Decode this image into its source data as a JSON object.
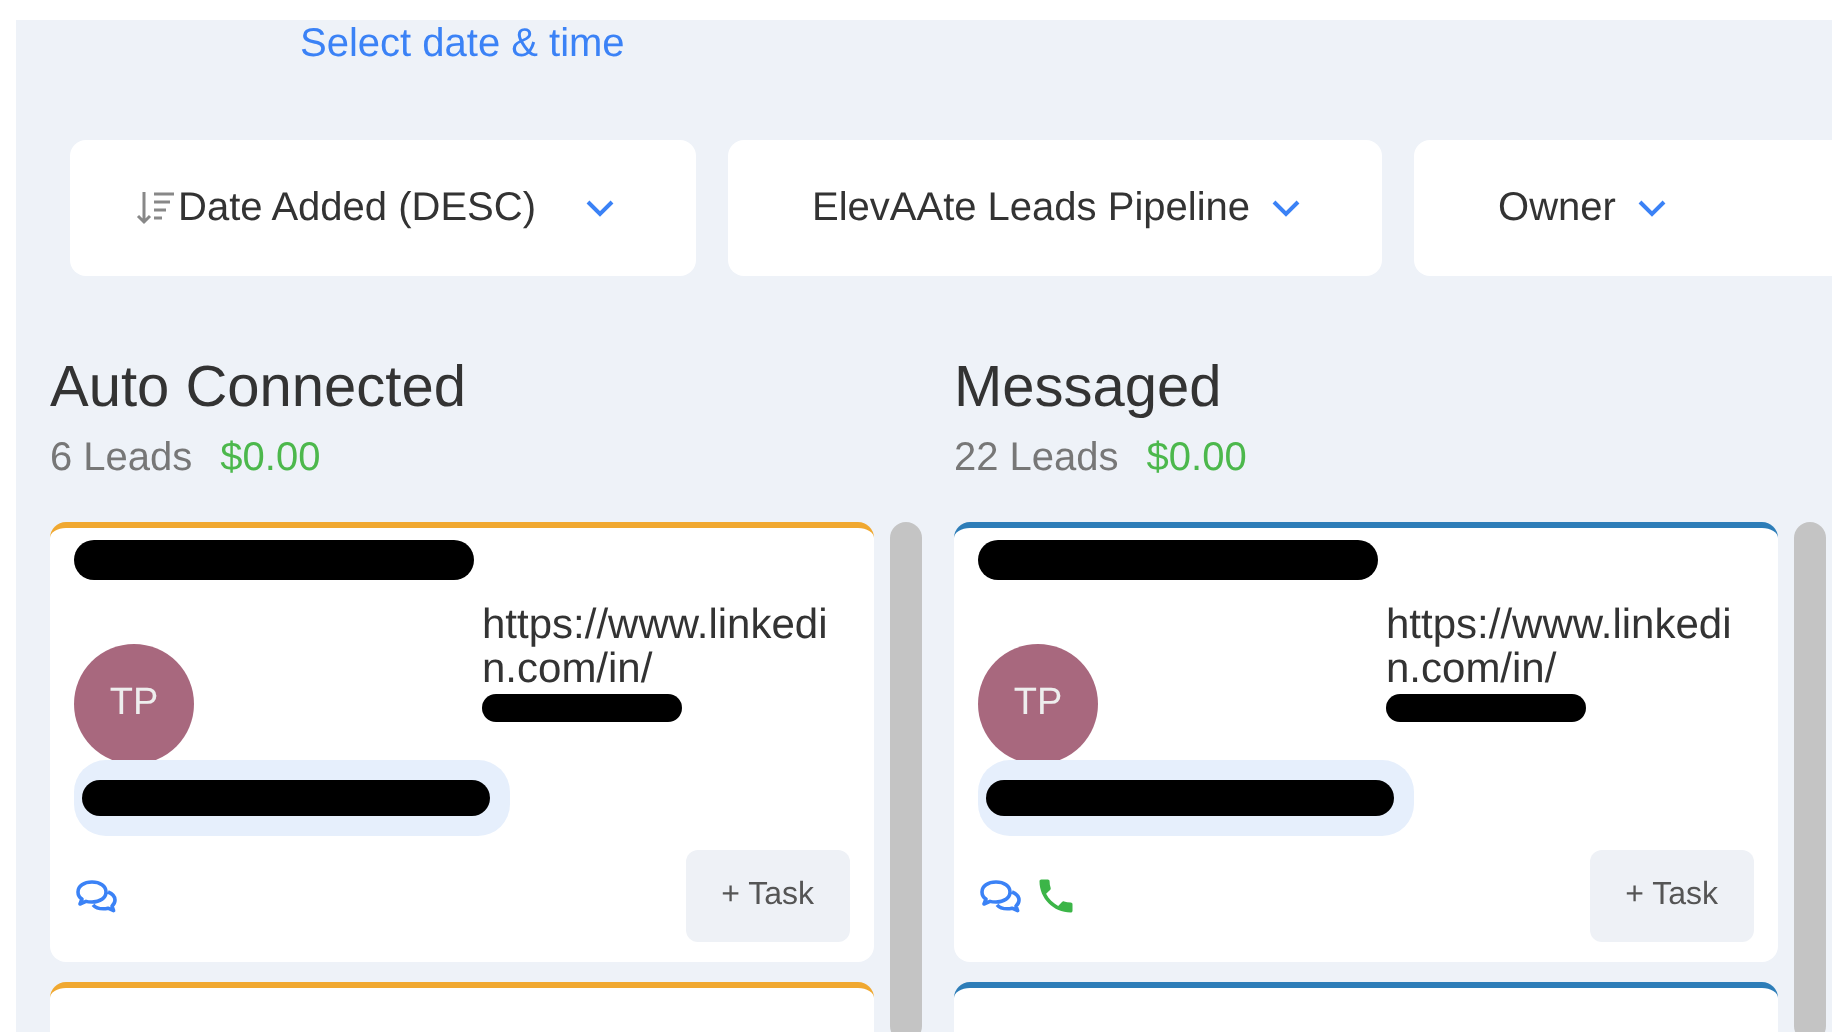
{
  "date_link": "Select date & time",
  "filters": [
    {
      "kind": "sort",
      "label": "Date Added (DESC)"
    },
    {
      "kind": "plain",
      "label": "ElevAAte Leads Pipeline"
    },
    {
      "kind": "plain",
      "label": "Owner"
    }
  ],
  "columns": [
    {
      "title": "Auto Connected",
      "count": "6 Leads",
      "value": "$0.00",
      "color": "#f0a830",
      "has_more": true,
      "cards": [
        {
          "initials": "TP",
          "url": "https://www.linkedin.com/in/",
          "channels": [
            {
              "kind": "message"
            }
          ],
          "task_button": "+ Task"
        }
      ]
    },
    {
      "title": "Messaged",
      "count": "22 Leads",
      "value": "$0.00",
      "color": "#2d7db8",
      "has_more": true,
      "cards": [
        {
          "initials": "TP",
          "url": "https://www.linkedin.com/in/",
          "channels": [
            {
              "kind": "message"
            },
            {
              "kind": "phone"
            }
          ],
          "task_button": "+ Task"
        }
      ]
    }
  ]
}
